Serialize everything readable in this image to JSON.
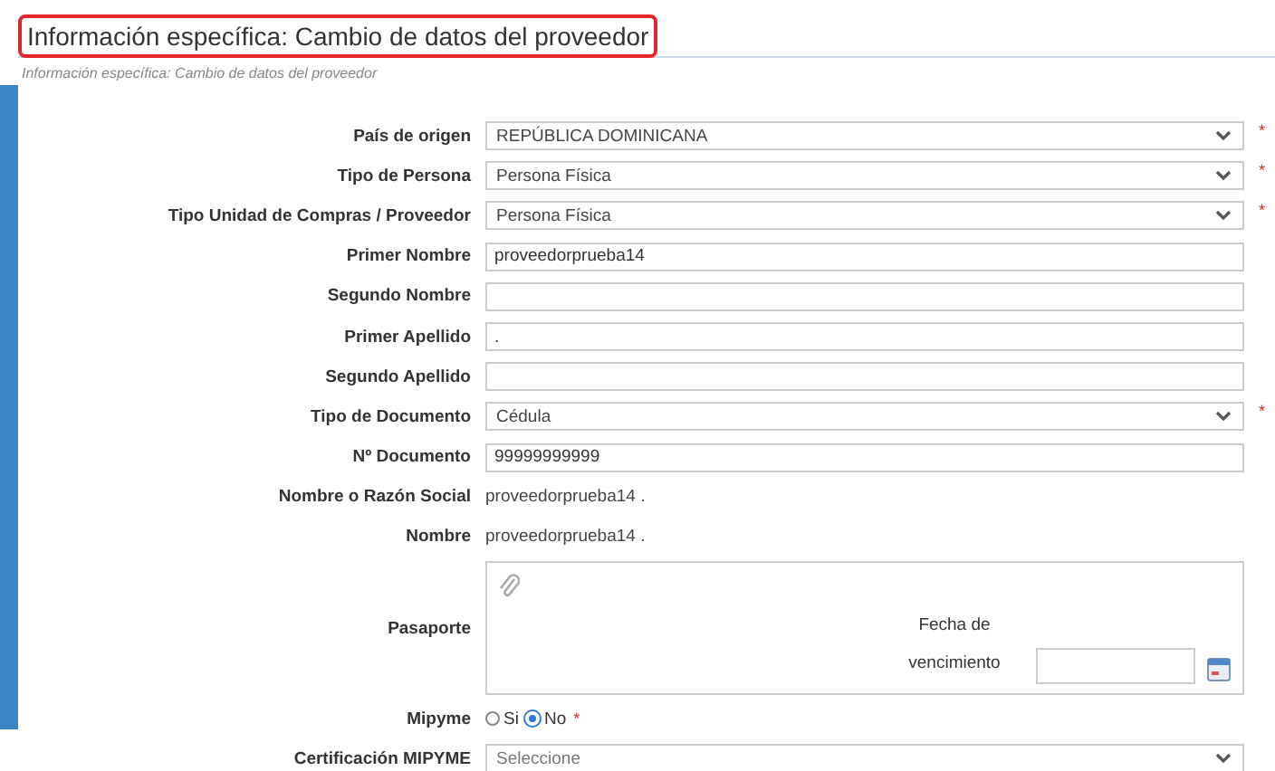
{
  "header": {
    "title": "Información específica: Cambio de datos del proveedor",
    "subtitle": "Información específica: Cambio de datos del proveedor"
  },
  "fields": [
    {
      "label": "País de origen",
      "kind": "select",
      "value": "REPÚBLICA DOMINICANA",
      "required_mark": "*"
    },
    {
      "label": "Tipo de Persona",
      "kind": "select",
      "value": "Persona Física",
      "required_mark": "*"
    },
    {
      "label": "Tipo Unidad de Compras / Proveedor",
      "kind": "select",
      "value": "Persona Física",
      "required_mark": "*"
    },
    {
      "label": "Primer Nombre",
      "kind": "input",
      "value": "proveedorprueba14"
    },
    {
      "label": "Segundo Nombre",
      "kind": "input"
    },
    {
      "label": "Primer Apellido",
      "kind": "input",
      "value": "."
    },
    {
      "label": "Segundo Apellido",
      "kind": "input"
    },
    {
      "label": "Tipo de Documento",
      "kind": "select",
      "value": "Cédula",
      "required_mark": "*"
    },
    {
      "label": "Nº Documento",
      "kind": "input",
      "value": "99999999999"
    },
    {
      "label": "Nombre o Razón Social",
      "kind": "text",
      "value": "proveedorprueba14 ."
    },
    {
      "label": "Nombre",
      "kind": "text",
      "value": "proveedorprueba14 ."
    },
    {
      "label": "Pasaporte",
      "kind": "passport",
      "date_label": "Fecha de vencimiento"
    },
    {
      "label": "Mipyme",
      "kind": "radio",
      "options": [
        {
          "label": "Si",
          "selected": false
        },
        {
          "label": "No",
          "selected": true
        }
      ],
      "required_mark": "*"
    },
    {
      "label": "Certificación MIPYME",
      "kind": "select",
      "placeholder": "Seleccione"
    }
  ]
}
